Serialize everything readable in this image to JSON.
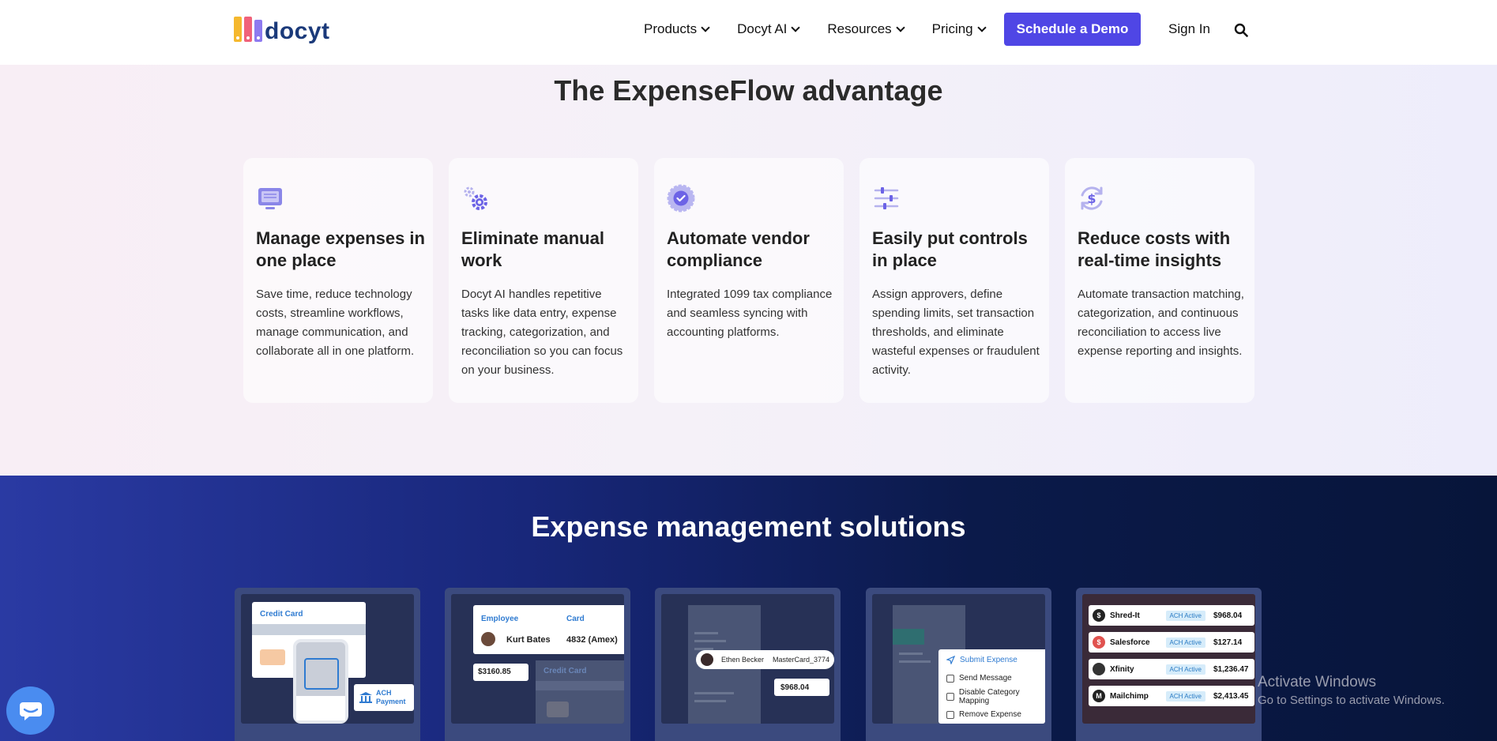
{
  "nav": {
    "logo_text": "docyt",
    "logo_colors": [
      "#f5b82e",
      "#f0627a",
      "#8e7af0"
    ],
    "items": [
      {
        "label": "Products"
      },
      {
        "label": "Docyt AI"
      },
      {
        "label": "Resources"
      },
      {
        "label": "Pricing"
      }
    ],
    "demo_label": "Schedule a Demo",
    "signin_label": "Sign In",
    "search_icon": "search-icon",
    "accent": "#4f46e5"
  },
  "advantage": {
    "title": "The ExpenseFlow advantage",
    "cards": [
      {
        "icon": "monitor-icon",
        "title": "Manage expenses in one place",
        "text": "Save time, reduce technology costs, streamline workflows, manage communication, and collaborate all in one platform."
      },
      {
        "icon": "gears-icon",
        "title": "Eliminate manual work",
        "text": "Docyt AI handles repetitive tasks like data entry, expense tracking, categorization, and reconciliation so you can focus on your business."
      },
      {
        "icon": "badge-check-icon",
        "title": "Automate vendor compliance",
        "text": "Integrated 1099 tax compliance and seamless syncing with accounting platforms."
      },
      {
        "icon": "sliders-icon",
        "title": "Easily put controls in place",
        "text": "Assign approvers, define spending limits, set transaction thresholds, and eliminate wasteful expenses or fraudulent activity."
      },
      {
        "icon": "dollar-cycle-icon",
        "title": "Reduce costs with real-time insights",
        "text": "Automate transaction matching, categorization, and continuous reconciliation to access live expense reporting and insights."
      }
    ]
  },
  "solutions": {
    "title": "Expense management solutions",
    "card1": {
      "credit_card": "Credit Card",
      "ach_line1": "ACH",
      "ach_line2": "Payment"
    },
    "card2": {
      "col1": "Employee",
      "col2": "Card",
      "name": "Kurt Bates",
      "card": "4832 (Amex)",
      "amount": "$3160.85",
      "credit_card": "Credit Card"
    },
    "card3": {
      "name": "Ethen Becker",
      "card": "MasterCard_3774",
      "amount": "$968.04"
    },
    "card4": {
      "menu": [
        "Submit Expense",
        "Send Message",
        "Disable Category Mapping",
        "Remove Expense"
      ]
    },
    "card5": {
      "vendors": [
        {
          "name": "Shred-It",
          "badge": "ACH Active",
          "amount": "$968.04",
          "color": "#222"
        },
        {
          "name": "Salesforce",
          "badge": "ACH Active",
          "amount": "$127.14",
          "color": "#e0524f"
        },
        {
          "name": "Xfinity",
          "badge": "ACH Active",
          "amount": "$1,236.47",
          "color": "#333"
        },
        {
          "name": "Mailchimp",
          "badge": "ACH Active",
          "amount": "$2,413.45",
          "color": "#222"
        }
      ]
    }
  },
  "watermark": {
    "line1": "Activate Windows",
    "line2": "Go to Settings to activate Windows."
  },
  "chat_icon": "chat-icon"
}
